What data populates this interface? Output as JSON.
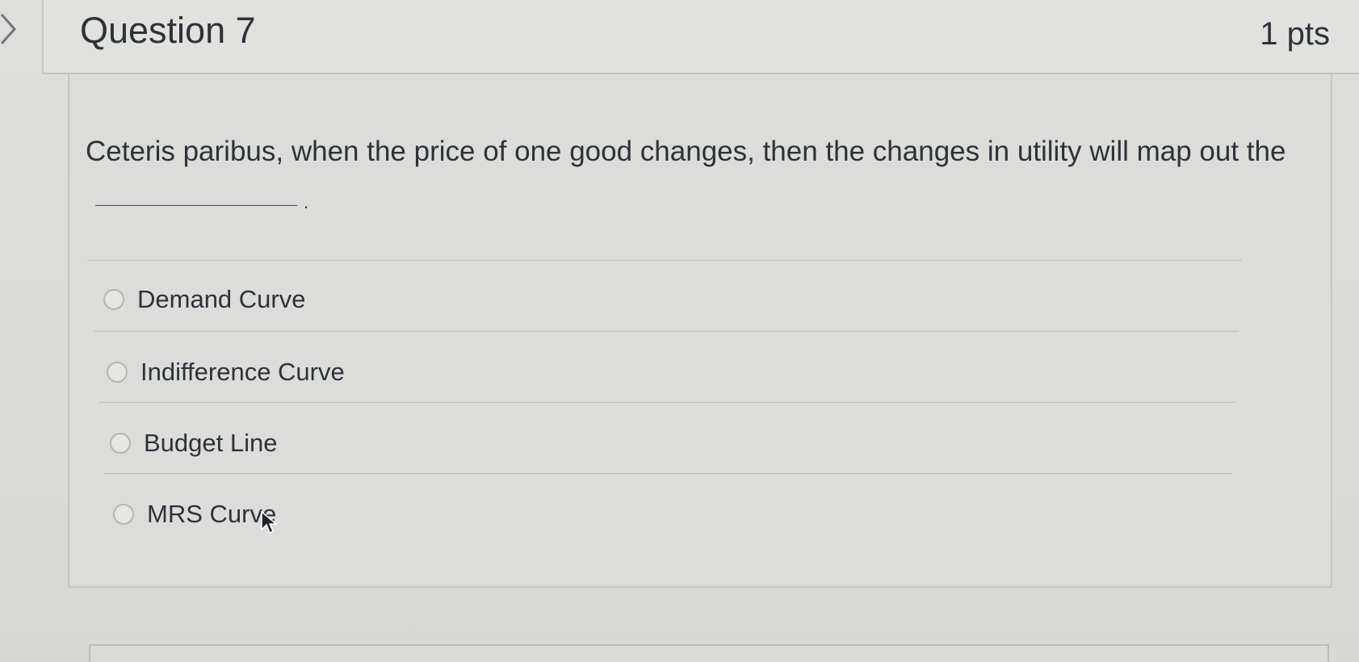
{
  "question": {
    "title": "Question 7",
    "points": "1 pts",
    "text": "Ceteris paribus, when the price of one good changes, then the changes in utility will map out the",
    "blank_suffix": "."
  },
  "answers": [
    {
      "label": "Demand Curve"
    },
    {
      "label": "Indifference Curve"
    },
    {
      "label": "Budget Line"
    },
    {
      "label": "MRS Curve"
    }
  ],
  "icons": {
    "nav": "chevron-right-icon",
    "cursor": "mouse-pointer-icon"
  },
  "colors": {
    "background": "#d9dad8",
    "text": "#2c3338",
    "border": "#c6c7c5"
  }
}
